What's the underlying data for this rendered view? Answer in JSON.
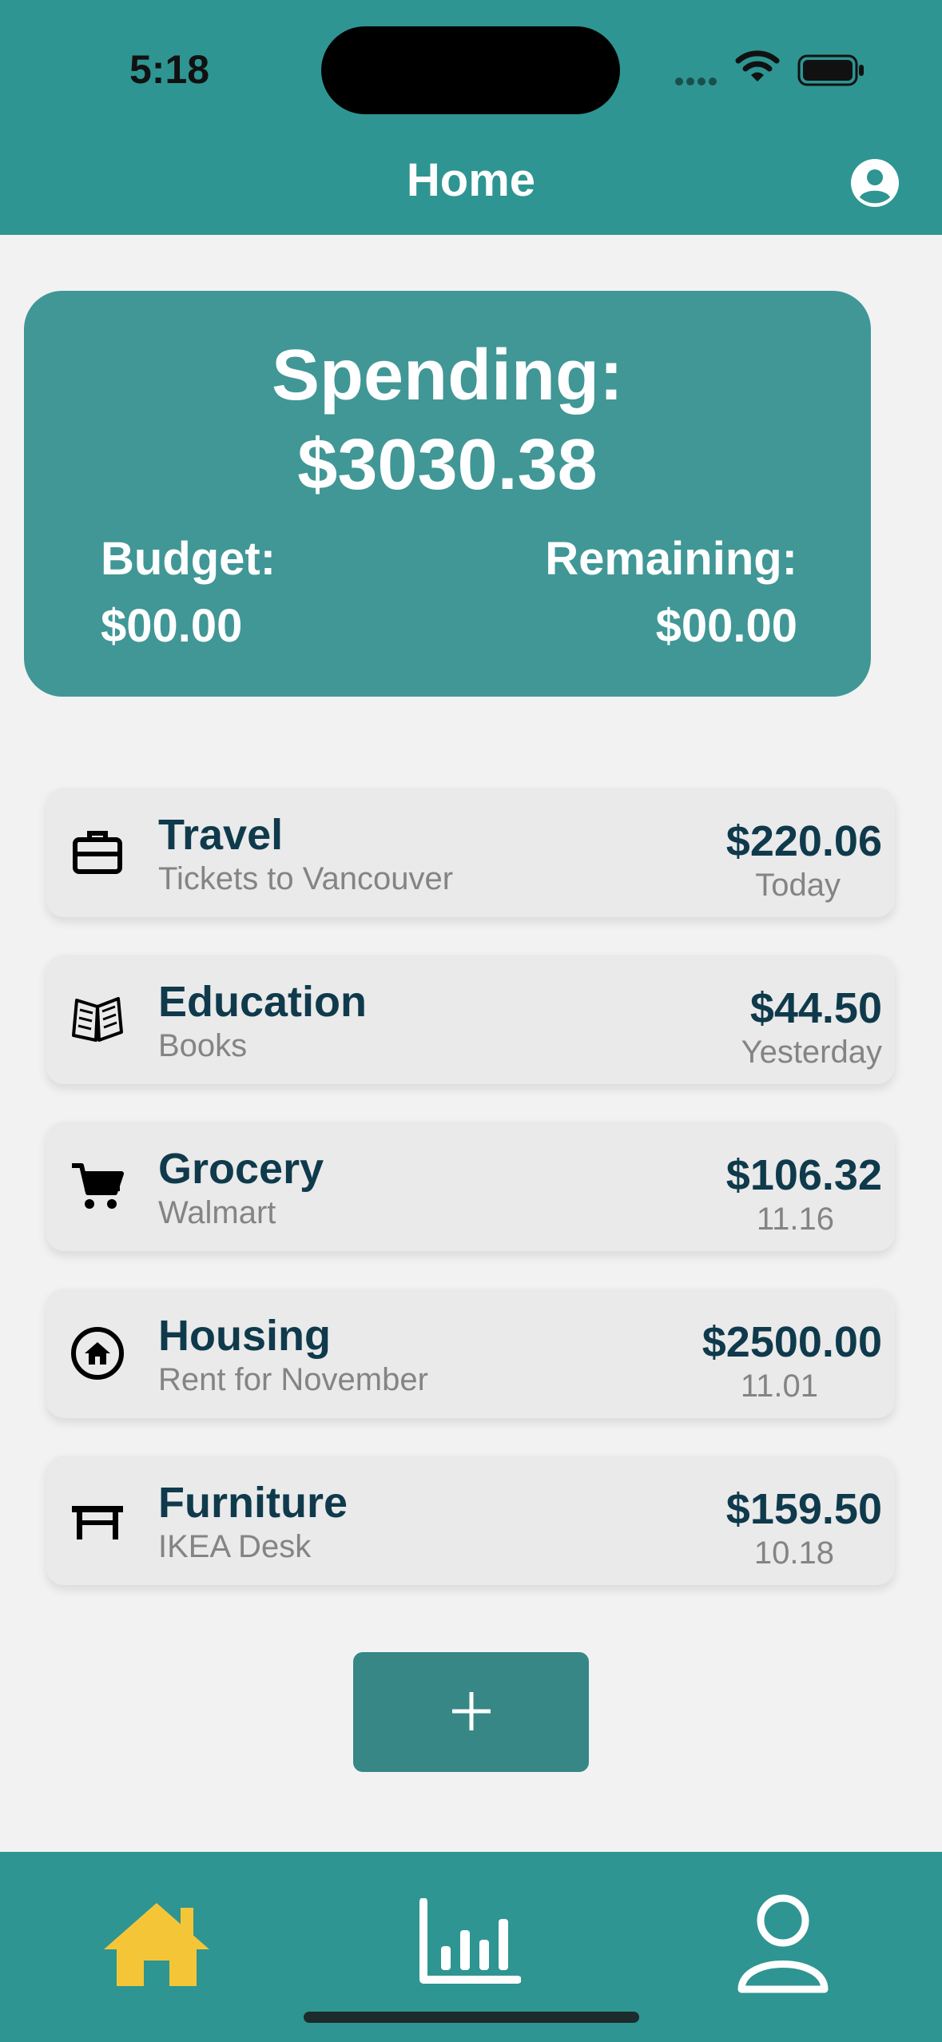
{
  "status_bar": {
    "time": "5:18"
  },
  "nav": {
    "title": "Home",
    "profile_icon": "user-circle-icon"
  },
  "summary": {
    "spending_label": "Spending:",
    "spending_value": "$3030.38",
    "budget_label": "Budget:",
    "budget_value": "$00.00",
    "remaining_label": "Remaining:",
    "remaining_value": "$00.00"
  },
  "transactions": [
    {
      "icon": "briefcase-icon",
      "category": "Travel",
      "description": "Tickets to Vancouver",
      "amount": "$220.06",
      "date": "Today"
    },
    {
      "icon": "book-icon",
      "category": "Education",
      "description": "Books",
      "amount": "$44.50",
      "date": "Yesterday"
    },
    {
      "icon": "cart-icon",
      "category": "Grocery",
      "description": "Walmart",
      "amount": "$106.32",
      "date": "11.16"
    },
    {
      "icon": "house-icon",
      "category": "Housing",
      "description": "Rent for November",
      "amount": "$2500.00",
      "date": "11.01"
    },
    {
      "icon": "desk-icon",
      "category": "Furniture",
      "description": "IKEA Desk",
      "amount": "$159.50",
      "date": "10.18"
    }
  ],
  "tabs": [
    {
      "name": "home",
      "icon": "home-icon",
      "active": true
    },
    {
      "name": "stats",
      "icon": "bar-chart-icon",
      "active": false
    },
    {
      "name": "profile",
      "icon": "person-icon",
      "active": false
    }
  ],
  "colors": {
    "primary": "#2e9592",
    "card": "#409796",
    "active_tab": "#f4c637",
    "text_dark": "#0f3a4c"
  }
}
